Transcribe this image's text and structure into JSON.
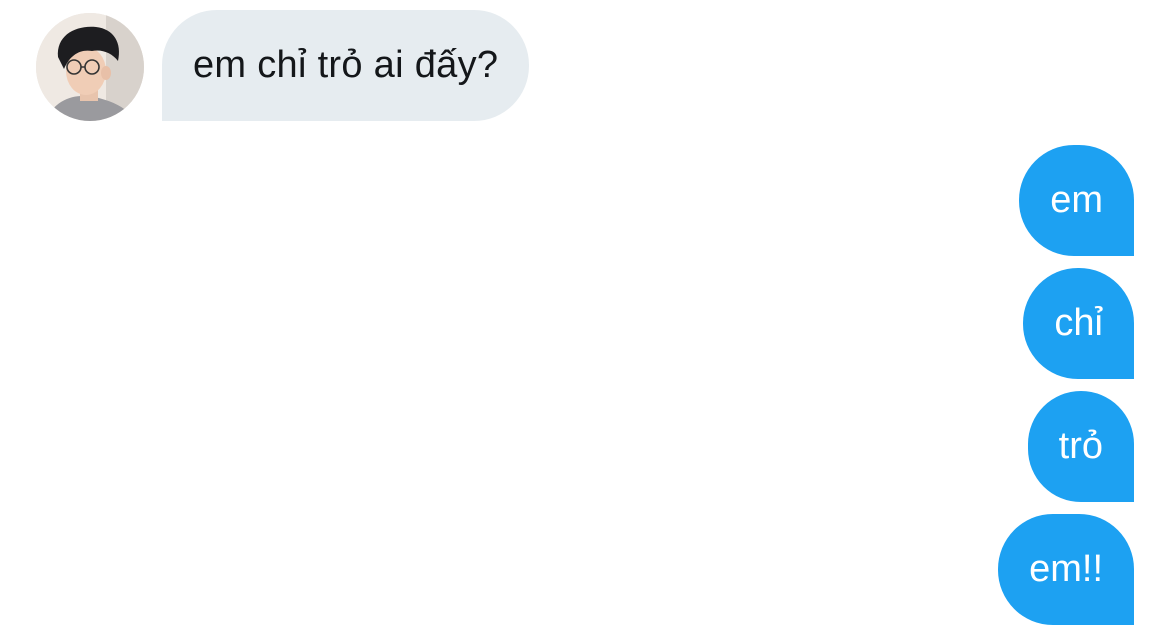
{
  "conversation": {
    "incoming": {
      "avatar_icon": "user-avatar-photo",
      "message": "em chỉ trỏ ai đấy?"
    },
    "outgoing": [
      {
        "text": "em"
      },
      {
        "text": "chỉ"
      },
      {
        "text": "trỏ"
      },
      {
        "text": "em!!"
      }
    ]
  },
  "colors": {
    "incoming_bubble": "#e6ecf0",
    "incoming_text": "#14171a",
    "outgoing_bubble": "#1da1f2",
    "outgoing_text": "#ffffff"
  }
}
